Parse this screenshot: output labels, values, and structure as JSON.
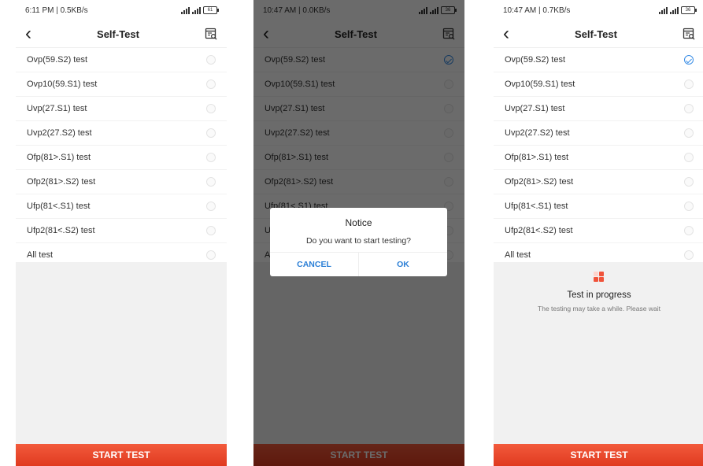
{
  "screens": [
    {
      "status": {
        "time": "6:11 PM | 0.5KB/s",
        "battery": "61"
      },
      "header": {
        "title": "Self-Test"
      },
      "tests": [
        {
          "label": "Ovp(59.S2) test",
          "checked": false
        },
        {
          "label": "Ovp10(59.S1) test",
          "checked": false
        },
        {
          "label": "Uvp(27.S1) test",
          "checked": false
        },
        {
          "label": "Uvp2(27.S2) test",
          "checked": false
        },
        {
          "label": "Ofp(81>.S1) test",
          "checked": false
        },
        {
          "label": "Ofp2(81>.S2) test",
          "checked": false
        },
        {
          "label": "Ufp(81<.S1) test",
          "checked": false
        },
        {
          "label": "Ufp2(81<.S2) test",
          "checked": false
        },
        {
          "label": "All test",
          "checked": false
        }
      ],
      "start_label": "START TEST"
    },
    {
      "status": {
        "time": "10:47 AM | 0.0KB/s",
        "battery": "36"
      },
      "header": {
        "title": "Self-Test"
      },
      "tests": [
        {
          "label": "Ovp(59.S2) test",
          "checked": true
        },
        {
          "label": "Ovp10(59.S1) test",
          "checked": false
        },
        {
          "label": "Uvp(27.S1) test",
          "checked": false
        },
        {
          "label": "Uvp2(27.S2) test",
          "checked": false
        },
        {
          "label": "Ofp(81>.S1) test",
          "checked": false
        },
        {
          "label": "Ofp2(81>.S2) test",
          "checked": false
        },
        {
          "label": "Ufp(81<.S1) test",
          "checked": false
        },
        {
          "label": "U",
          "checked": false
        },
        {
          "label": "A",
          "checked": false
        }
      ],
      "start_label": "START TEST",
      "dialog": {
        "title": "Notice",
        "message": "Do you want to start testing?",
        "cancel_label": "CANCEL",
        "ok_label": "OK"
      }
    },
    {
      "status": {
        "time": "10:47 AM | 0.7KB/s",
        "battery": "36"
      },
      "header": {
        "title": "Self-Test"
      },
      "tests": [
        {
          "label": "Ovp(59.S2) test",
          "checked": true
        },
        {
          "label": "Ovp10(59.S1) test",
          "checked": false
        },
        {
          "label": "Uvp(27.S1) test",
          "checked": false
        },
        {
          "label": "Uvp2(27.S2) test",
          "checked": false
        },
        {
          "label": "Ofp(81>.S1) test",
          "checked": false
        },
        {
          "label": "Ofp2(81>.S2) test",
          "checked": false
        },
        {
          "label": "Ufp(81<.S1) test",
          "checked": false
        },
        {
          "label": "Ufp2(81<.S2) test",
          "checked": false
        },
        {
          "label": "All test",
          "checked": false
        }
      ],
      "start_label": "START TEST",
      "progress": {
        "title": "Test in progress",
        "subtitle": "The testing may take a while. Please wait"
      }
    }
  ],
  "colors": {
    "accent_red": "#e8452a",
    "check_blue": "#3a8ee6",
    "dialog_button_blue": "#2b7fd6"
  },
  "icons": {
    "back": "chevron-left-icon",
    "report": "report-icon",
    "radio": "radio-icon",
    "progress": "progress-icon"
  }
}
